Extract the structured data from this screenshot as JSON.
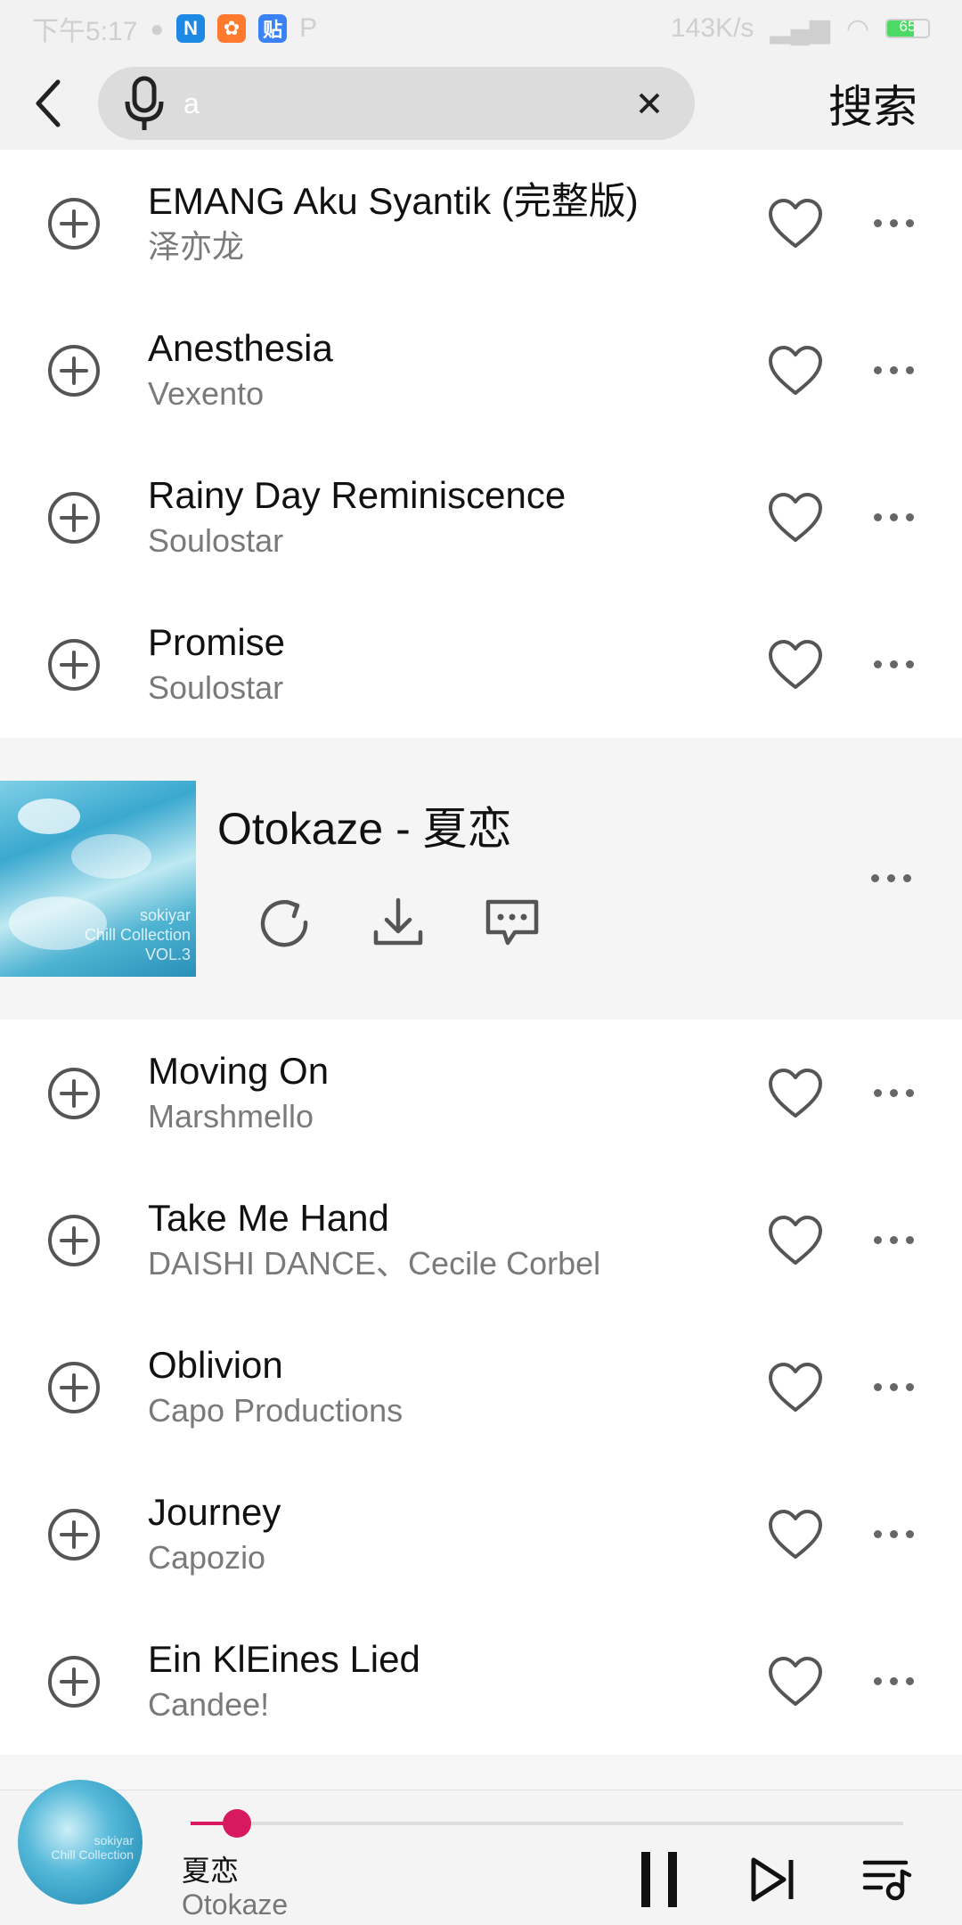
{
  "status_bar": {
    "time": "下午5:17",
    "apps": [
      "N",
      "贴"
    ],
    "speed": "143K/s",
    "battery": "65",
    "battery_percent": 65
  },
  "search": {
    "query": "a",
    "action_label": "搜索"
  },
  "songs_before": [
    {
      "title": "EMANG Aku Syantik (完整版)",
      "artist": "泽亦龙"
    },
    {
      "title": "Anesthesia",
      "artist": "Vexento"
    },
    {
      "title": "Rainy Day Reminiscence",
      "artist": "Soulostar"
    },
    {
      "title": "Promise",
      "artist": "Soulostar"
    }
  ],
  "expanded": {
    "title": "Otokaze - 夏恋",
    "cover_text": [
      "sokiyar",
      "Chill Collection",
      "VOL.3"
    ]
  },
  "songs_after": [
    {
      "title": "Moving On",
      "artist": "Marshmello"
    },
    {
      "title": "Take Me Hand",
      "artist": "DAISHI DANCE、Cecile Corbel"
    },
    {
      "title": "Oblivion",
      "artist": "Capo Productions"
    },
    {
      "title": "Journey",
      "artist": "Capozio"
    },
    {
      "title": "Ein KlEines Lied",
      "artist": "Candee!"
    }
  ],
  "now_playing": {
    "title": "夏恋",
    "artist": "Otokaze",
    "progress": 0.065
  },
  "colors": {
    "accent": "#d8195f",
    "battery": "#4cd964"
  },
  "icons": {
    "back": "back-arrow-icon",
    "mic": "microphone-icon",
    "clear": "close-icon",
    "add": "add-circle-icon",
    "like": "heart-icon",
    "more": "more-horizontal-icon",
    "replay": "replay-icon",
    "download": "download-icon",
    "comment": "comment-icon",
    "pause": "pause-icon",
    "next": "skip-next-icon",
    "playlist": "playlist-icon"
  }
}
